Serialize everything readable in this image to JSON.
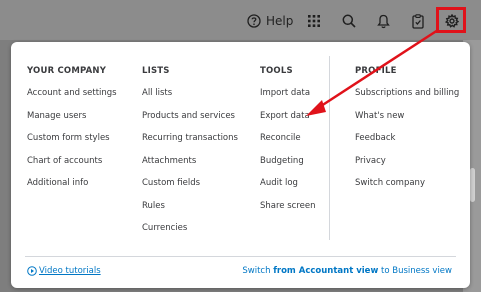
{
  "topbar": {
    "help_label": "Help",
    "icons": [
      "help-icon",
      "apps-grid-icon",
      "search-icon",
      "bell-icon",
      "clipboard-icon",
      "gear-icon"
    ]
  },
  "menu": {
    "columns": [
      {
        "heading": "YOUR COMPANY",
        "items": [
          "Account and settings",
          "Manage users",
          "Custom form styles",
          "Chart of accounts",
          "Additional info"
        ]
      },
      {
        "heading": "LISTS",
        "items": [
          "All lists",
          "Products and services",
          "Recurring transactions",
          "Attachments",
          "Custom fields",
          "Rules",
          "Currencies"
        ]
      },
      {
        "heading": "TOOLS",
        "items": [
          "Import data",
          "Export data",
          "Reconcile",
          "Budgeting",
          "Audit log",
          "Share screen"
        ]
      },
      {
        "heading": "PROFILE",
        "items": [
          "Subscriptions and billing",
          "What's new",
          "Feedback",
          "Privacy",
          "Switch company"
        ]
      }
    ],
    "footer": {
      "video_label": "Video tutorials",
      "switch_prefix": "Switch ",
      "switch_bold": "from Accountant view",
      "switch_suffix": " to Business view"
    }
  },
  "colors": {
    "link": "#0077c5",
    "annotation_red": "#e0121a",
    "text": "#393a3d"
  }
}
